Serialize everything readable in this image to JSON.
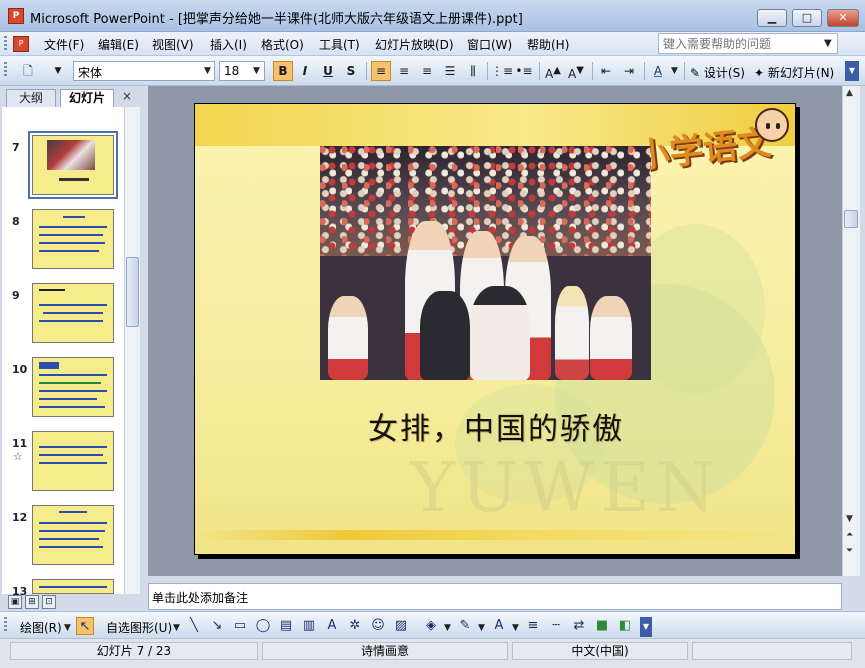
{
  "window": {
    "title": "Microsoft PowerPoint - [把掌声分给她一半课件(北师大版六年级语文上册课件).ppt]",
    "minimize_icon": "minimize-icon",
    "maximize_icon": "maximize-icon",
    "close_icon": "close-icon"
  },
  "menu": {
    "items": [
      "文件(F)",
      "编辑(E)",
      "视图(V)",
      "插入(I)",
      "格式(O)",
      "工具(T)",
      "幻灯片放映(D)",
      "窗口(W)",
      "帮助(H)"
    ],
    "help_placeholder": "键入需要帮助的问题"
  },
  "toolbar": {
    "font_name": "宋体",
    "font_size": "18",
    "bold": "B",
    "italic": "I",
    "underline": "U",
    "shadow": "S",
    "design_label": "设计(S)",
    "new_slide_label": "新幻灯片(N)"
  },
  "left_pane": {
    "tabs": [
      "大纲",
      "幻灯片"
    ],
    "close_label": "×",
    "slides": [
      {
        "number": "7",
        "selected": true
      },
      {
        "number": "8"
      },
      {
        "number": "9"
      },
      {
        "number": "10"
      },
      {
        "number": "11",
        "mark": "☆"
      },
      {
        "number": "12"
      },
      {
        "number": "13"
      }
    ]
  },
  "slide": {
    "caption": "女排，中国的骄傲",
    "logo_text": "小学语文",
    "watermark": "YUWEN"
  },
  "notes": {
    "placeholder": "单击此处添加备注"
  },
  "drawing_toolbar": {
    "draw_label": "绘图(R)",
    "autoshapes_label": "自选图形(U)"
  },
  "status": {
    "slide_position": "幻灯片 7 / 23",
    "design_name": "诗情画意",
    "language": "中文(中国)"
  },
  "colors": {
    "accent": "#f7c26b",
    "slide_background": "#f6ed9e",
    "titlebar": "#c9d9ef"
  }
}
